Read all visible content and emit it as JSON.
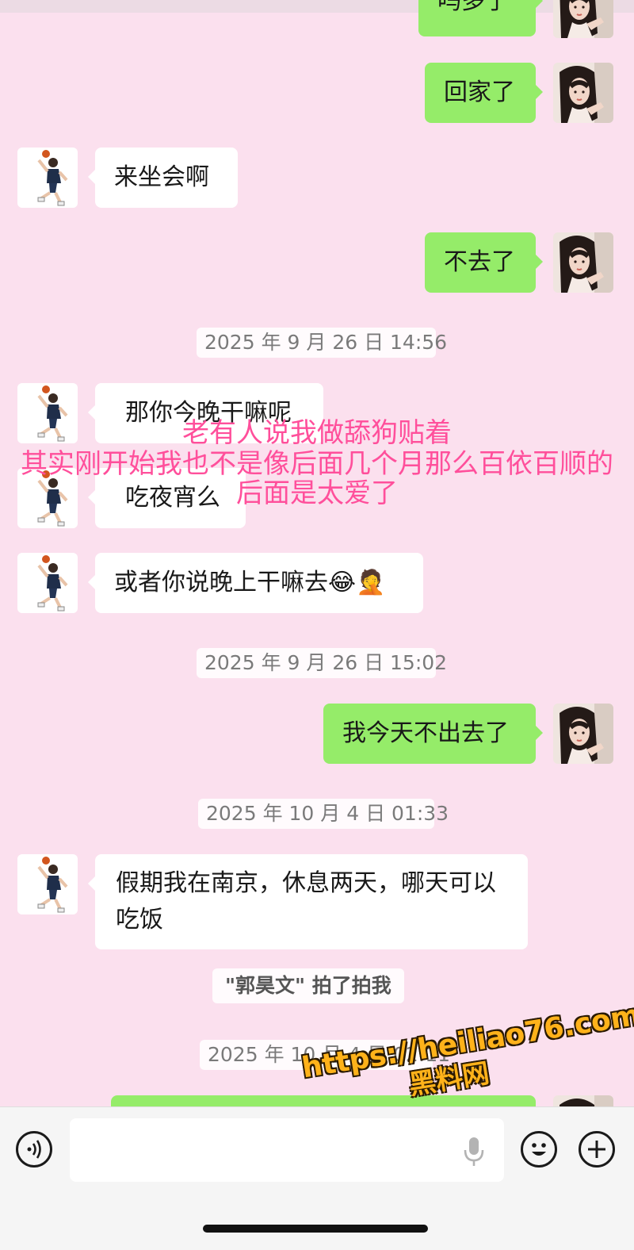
{
  "messages": {
    "m1": "吗多了",
    "m2": "回家了",
    "m3": "来坐会啊",
    "m4": "不去了",
    "t1": "2025 年 9 月 26 日 14:56",
    "m5": "那你今晚干嘛呢",
    "m6": "吃夜宵么",
    "m7": "或者你说晚上干嘛去",
    "m7_emoji": "😂🤦",
    "t2": "2025 年 9 月 26 日 15:02",
    "m8": "我今天不出去了",
    "t3": "2025 年 10 月 4 日 01:33",
    "m9": "假期我在南京，休息两天，哪天可以吃饭",
    "sys1": "\"郭昊文\" 拍了拍我",
    "t4": "2025 年 10 月 4 日 02:11"
  },
  "overlay_caption": {
    "line1": "老有人说我做舔狗贴着",
    "line2": "其实刚开始我也不是像后面几个月那么百依百顺的",
    "line3": "后面是太爱了"
  },
  "watermark": {
    "url": "https://heiliao76.com",
    "name": "黑料网"
  },
  "input_bar": {
    "voice_icon": "voice-icon",
    "mic_icon": "microphone-icon",
    "emoji_icon": "emoji-icon",
    "plus_icon": "plus-icon"
  },
  "colors": {
    "background": "#fbe0ee",
    "sent_bubble": "#95ec69",
    "received_bubble": "#ffffff",
    "overlay_text": "#ff4f9b",
    "watermark": "#ffb21a"
  }
}
